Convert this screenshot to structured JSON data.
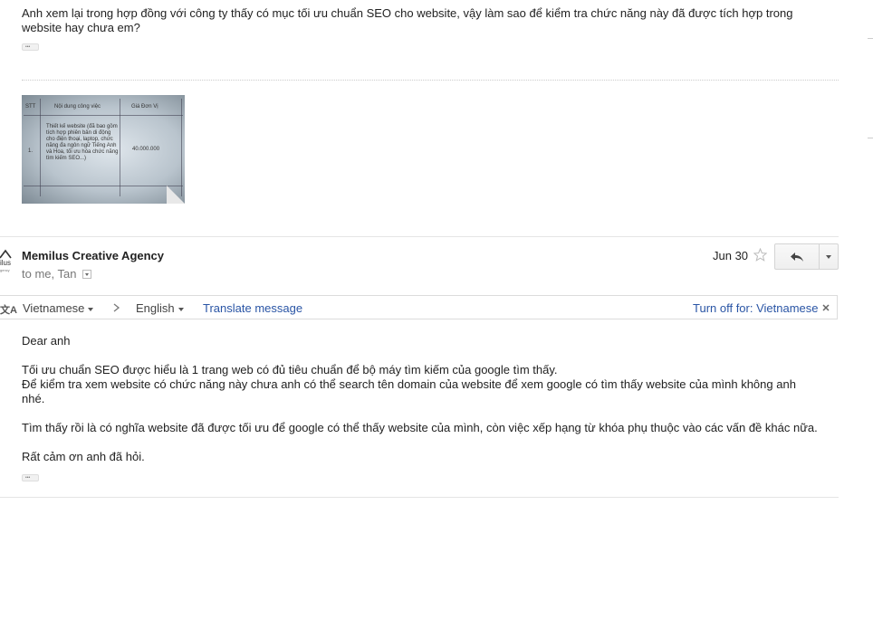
{
  "message1": {
    "body": "Anh xem lại trong hợp đồng với công ty thấy có mục tối ưu chuẩn SEO cho website, vậy làm sao để kiểm tra chức năng này đã được tích hợp trong website hay chưa em?",
    "attachment": {
      "headers": [
        "STT",
        "Nội dung công việc",
        "Giá Đơn Vị"
      ],
      "row_index": "1.",
      "row_desc": "Thiết kế website (đã bao gồm tích hợp phiên bản di động cho điện thoại, laptop, chức năng đa ngôn ngữ Tiếng Anh và Hoa, tối ưu hóa chức năng tìm kiếm SEO...)",
      "row_price": "40.000.000"
    }
  },
  "message2": {
    "sender": "Memilus Creative Agency",
    "recipients": "to me, Tan",
    "date": "Jun 30",
    "avatar_text": "ilus",
    "avatar_sub": "gency",
    "translate": {
      "from_lang": "Vietnamese",
      "to_lang": "English",
      "action": "Translate message",
      "turn_off": "Turn off for: Vietnamese"
    },
    "body": {
      "greeting": "Dear anh",
      "p1_line1": "Tối ưu chuẩn SEO được hiểu là 1 trang web có đủ tiêu chuẩn để bộ máy tìm kiếm của google tìm thấy.",
      "p1_line2": "Để kiểm tra xem website có chức năng này chưa anh có thể search tên domain của website để xem google có tìm thấy website của mình không anh nhé.",
      "p2": "Tìm thấy rồi là có nghĩa website đã được tối ưu để google có thể thấy website của mình, còn việc xếp hạng từ khóa phụ thuộc vào các vấn đề khác nữa.",
      "closing": "Rất cảm ơn anh đã hỏi."
    }
  },
  "icons": {
    "star": "star-icon",
    "reply": "reply-icon",
    "more": "chevron-down-icon",
    "translate": "translate-icon",
    "close": "close-icon"
  }
}
